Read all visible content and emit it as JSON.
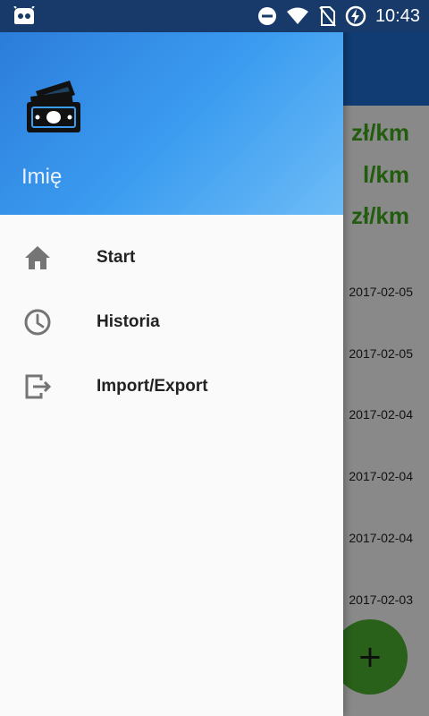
{
  "status_bar": {
    "time": "10:43",
    "icons": [
      "android-debug-icon",
      "do-not-disturb-icon",
      "wifi-icon",
      "no-sim-icon",
      "battery-charging-icon"
    ]
  },
  "drawer": {
    "header": {
      "user_name": "Imię",
      "logo_icon": "money-stack-icon"
    },
    "items": [
      {
        "label": "Start",
        "icon": "home-icon"
      },
      {
        "label": "Historia",
        "icon": "clock-icon"
      },
      {
        "label": "Import/Export",
        "icon": "exit-to-app-icon"
      }
    ]
  },
  "background": {
    "stats": [
      "zł/km",
      "l/km",
      "zł/km"
    ],
    "rows": [
      "2017-02-05",
      "2017-02-05",
      "2017-02-04",
      "2017-02-04",
      "2017-02-04",
      "2017-02-03"
    ],
    "fab_label": "+"
  },
  "colors": {
    "status_bar": "#173a6b",
    "toolbar": "#1e6cd1",
    "header_gradient_start": "#2a79d8",
    "header_gradient_end": "#6ebcf6",
    "stat_green": "#3fa81a",
    "fab_green": "#4caf30"
  }
}
